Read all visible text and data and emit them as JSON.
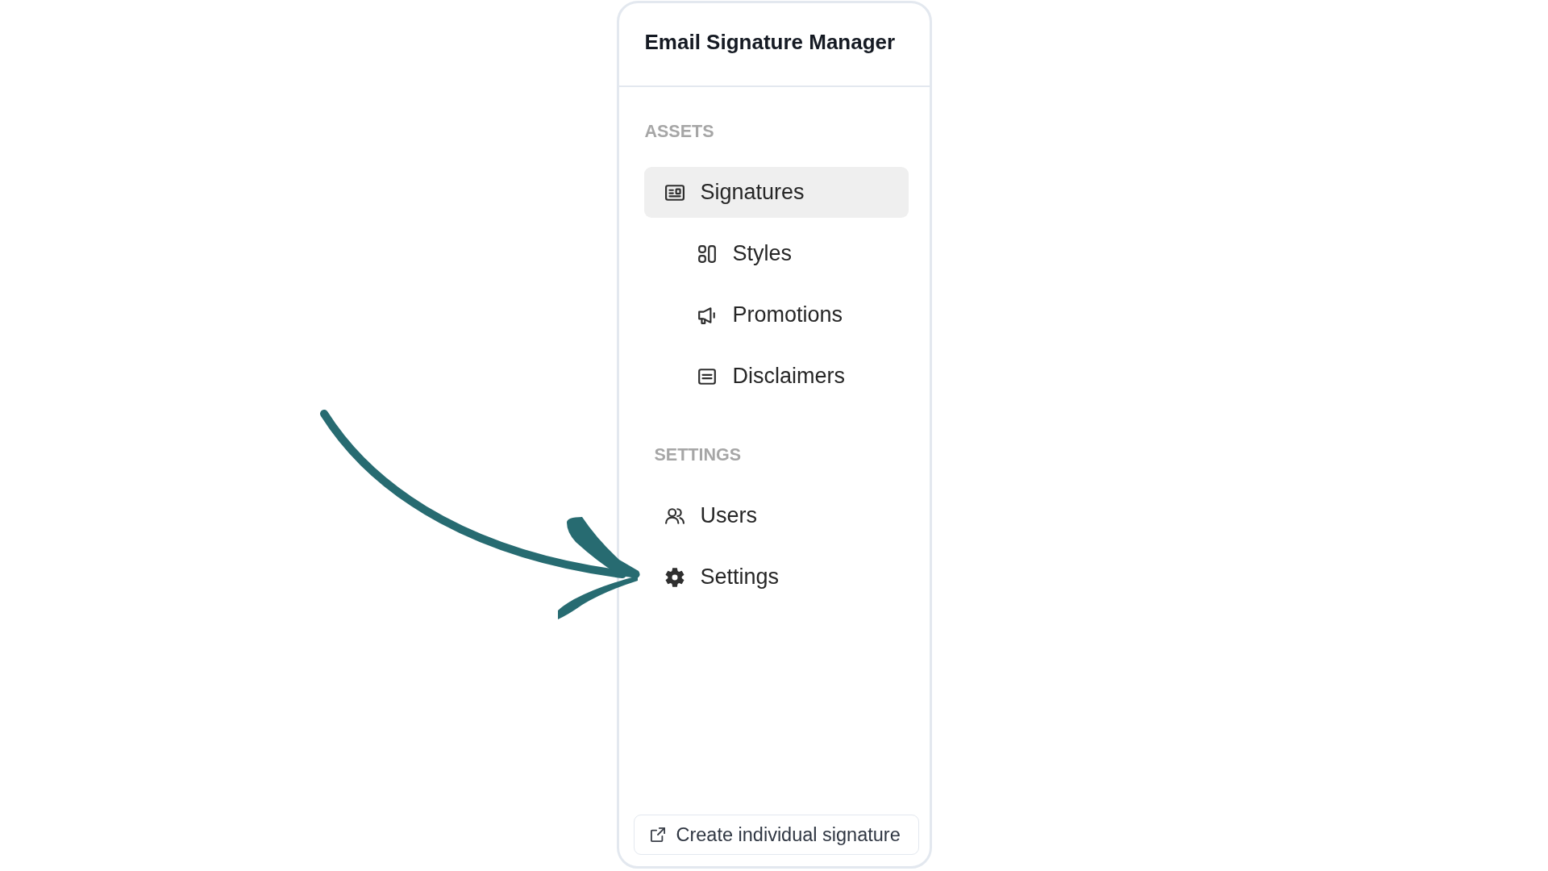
{
  "sidebar": {
    "title": "Email Signature Manager",
    "sections": [
      {
        "heading": "ASSETS",
        "items": [
          {
            "label": "Signatures",
            "selected": true,
            "children": [
              {
                "label": "Styles",
                "selected": false
              },
              {
                "label": "Promotions",
                "selected": false
              },
              {
                "label": "Disclaimers",
                "selected": false
              }
            ]
          }
        ]
      },
      {
        "heading": "SETTINGS",
        "items": [
          {
            "label": "Users",
            "selected": false
          },
          {
            "label": "Settings",
            "selected": false
          }
        ]
      }
    ],
    "footer_button": {
      "label": "Create individual signature"
    }
  }
}
